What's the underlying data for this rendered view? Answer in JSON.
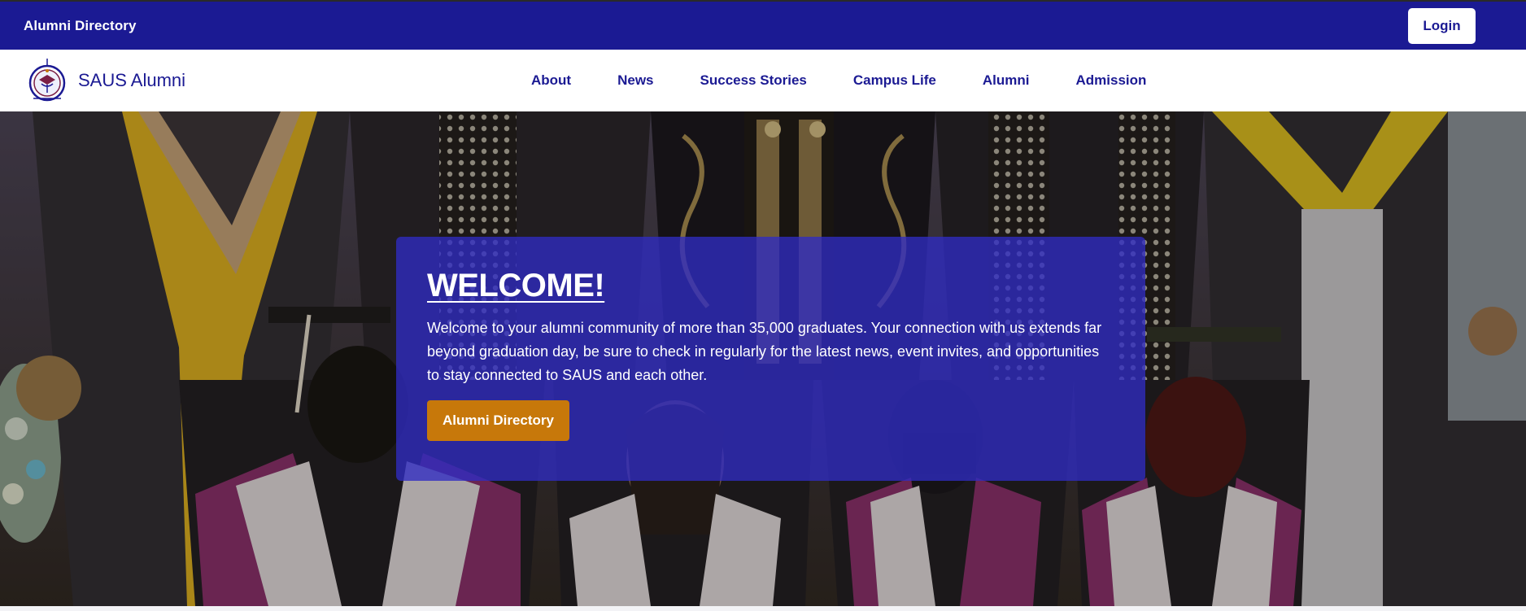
{
  "topbar": {
    "title": "Alumni Directory",
    "login_label": "Login"
  },
  "navbar": {
    "brand_name": "SAUS Alumni",
    "links": [
      {
        "label": "About"
      },
      {
        "label": "News"
      },
      {
        "label": "Success Stories"
      },
      {
        "label": "Campus Life"
      },
      {
        "label": "Alumni"
      },
      {
        "label": "Admission"
      }
    ]
  },
  "hero": {
    "heading": "WELCOME!",
    "text": "Welcome to your alumni community of more than 35,000 graduates. Your connection with us extends far beyond graduation day, be sure to check in regularly for the latest news, event invites, and opportunities to stay connected to SAUS and each other.",
    "button_label": "Alumni Directory"
  },
  "colors": {
    "brand_navy": "#1b1a93",
    "card_overlay": "#2f2bc3",
    "button_gold": "#c7780a",
    "white": "#ffffff"
  }
}
